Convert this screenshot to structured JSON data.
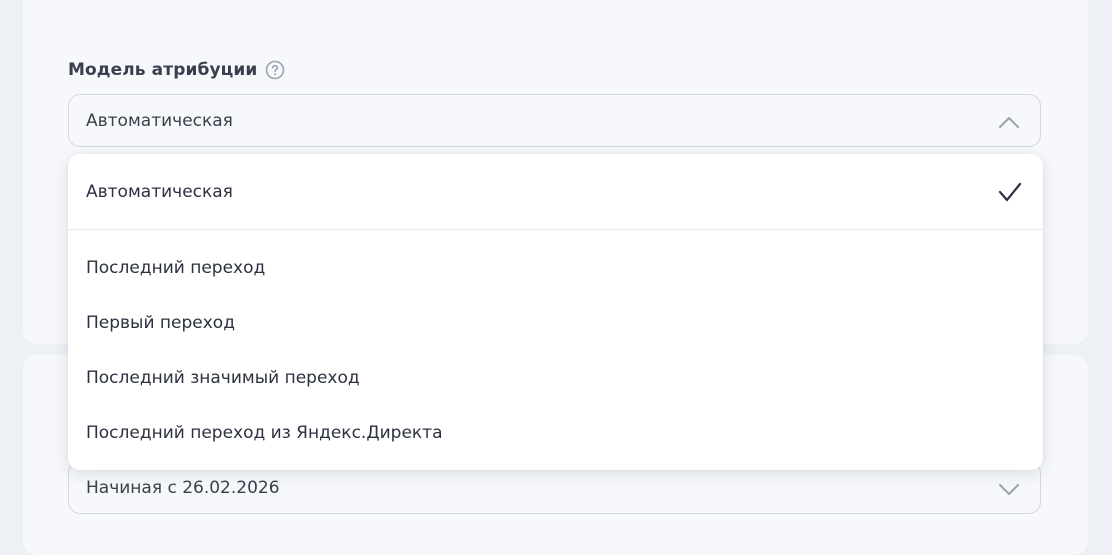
{
  "attribution": {
    "label": "Модель атрибуции",
    "selected_value": "Автоматическая",
    "options": [
      {
        "label": "Автоматическая",
        "selected": true
      },
      {
        "label": "Последний переход",
        "selected": false
      },
      {
        "label": "Первый переход",
        "selected": false
      },
      {
        "label": "Последний значимый переход",
        "selected": false
      },
      {
        "label": "Последний переход из Яндекс.Директа",
        "selected": false
      }
    ]
  },
  "period": {
    "selected_value": "Начиная с 26.02.2026"
  },
  "icons": {
    "help": "question-circle-icon",
    "chevron_up": "chevron-up-icon",
    "chevron_down": "chevron-down-icon",
    "check": "check-icon"
  },
  "colors": {
    "background": "#edf0f5",
    "card": "#f6f8fb",
    "dropdown": "#ffffff",
    "text": "#2c3140",
    "border": "#d3d7e0",
    "icon": "#9aa1b0"
  }
}
